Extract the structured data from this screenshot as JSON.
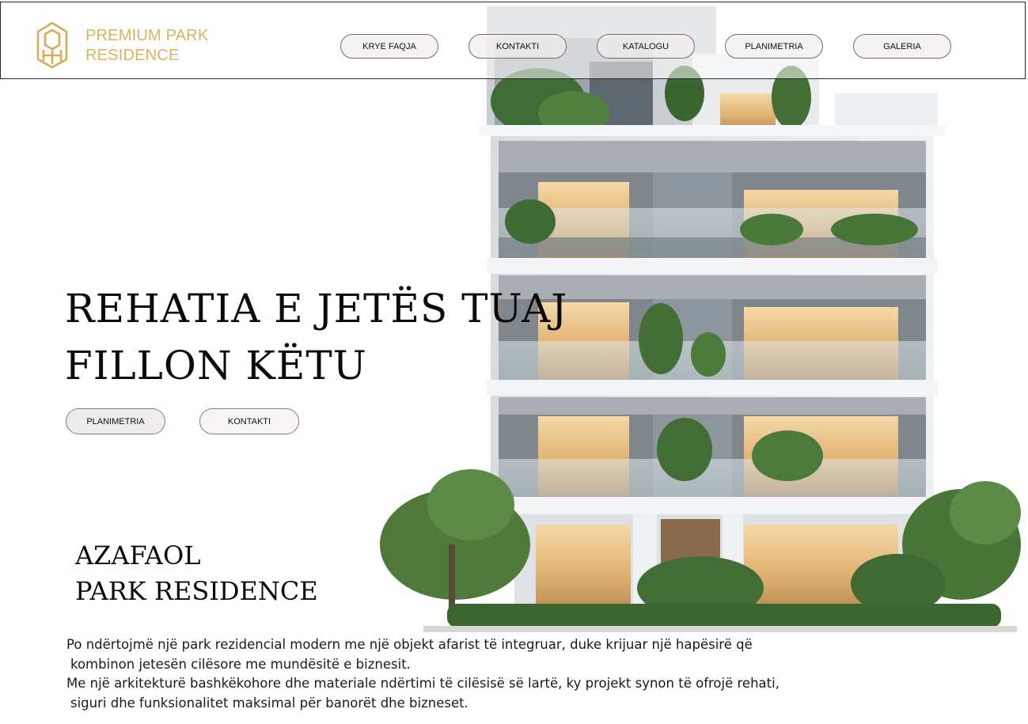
{
  "brand": {
    "line1": "PREMIUM PARK",
    "line2": "RESIDENCE",
    "logo_icon": "building-logo-icon",
    "color": "#d9b35f"
  },
  "nav": {
    "items": [
      {
        "label": "KRYE FAQJA"
      },
      {
        "label": "KONTAKTI"
      },
      {
        "label": "KATALOGU"
      },
      {
        "label": "PLANIMETRIA"
      },
      {
        "label": "GALERIA"
      }
    ]
  },
  "hero": {
    "title_line1": "REHATIA E JETËS TUAJ",
    "title_line2": "FILLON KËTU",
    "buttons": [
      {
        "label": "PLANIMETRIA"
      },
      {
        "label": "KONTAKTI"
      }
    ]
  },
  "project": {
    "name_line1": "AZAFAOL",
    "name_line2": "PARK RESIDENCE",
    "description": [
      "Po ndërtojmë një park rezidencial modern me një objekt afarist të integruar, duke krijuar një hapësirë që",
      "kombinon jetesën cilësore me mundësitë e biznesit.",
      "Me një arkitekturë bashkëkohore dhe materiale ndërtimi të cilësisë së lartë, ky projekt synon të ofrojë rehati,",
      "siguri dhe funksionalitet maksimal për banorët dhe bizneset."
    ]
  },
  "image": {
    "subject": "building-illustration"
  }
}
